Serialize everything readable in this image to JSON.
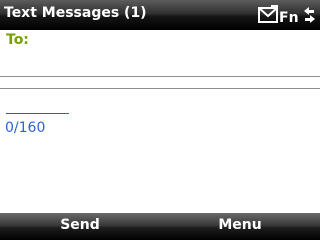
{
  "titlebar": {
    "title": "Text Messages (1)",
    "icons": [
      "envelope-icon",
      "fn-indicator-icon",
      "connectivity-arrows-icon"
    ],
    "fn_text": "Fn"
  },
  "compose": {
    "to_label": "To:",
    "to_value": "",
    "message_text": "",
    "char_count": "0/160"
  },
  "softkeys": {
    "left": "Send",
    "right": "Menu"
  },
  "colors": {
    "to_label": "#77a000",
    "counter": "#2b63d8",
    "bar_dark": "#000000"
  }
}
